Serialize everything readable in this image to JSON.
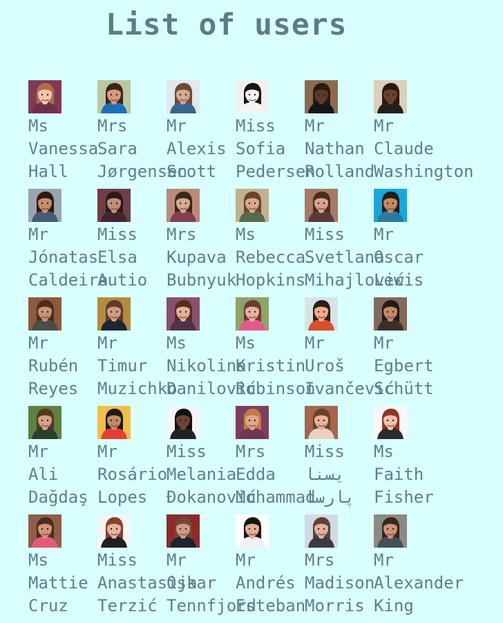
{
  "page": {
    "title": "List of users"
  },
  "users": [
    {
      "title": "Ms",
      "first": "Vanessa",
      "last": "Hall",
      "skin": "#f1c6b0",
      "hair": "#b06d4a",
      "shirt": "#6d2f4d",
      "bg": "#7f3a56"
    },
    {
      "title": "Mrs",
      "first": "Sara",
      "last": "Jørgensen",
      "skin": "#d79b7c",
      "hair": "#3d2418",
      "shirt": "#1e6fb5",
      "bg": "#b8c7a4"
    },
    {
      "title": "Mr",
      "first": "Alexis",
      "last": "Scott",
      "skin": "#d4a98f",
      "hair": "#6b4a38",
      "shirt": "#39648f",
      "bg": "#e3e6ea"
    },
    {
      "title": "Miss",
      "first": "Sofia",
      "last": "Pedersen",
      "skin": "#f1efef",
      "hair": "#161616",
      "shirt": "#f5f5f5",
      "bg": "#f0f0f0"
    },
    {
      "title": "Mr",
      "first": "Nathan",
      "last": "Rolland",
      "skin": "#5b3a28",
      "hair": "#2a1a12",
      "shirt": "#161616",
      "bg": "#8b6b4e"
    },
    {
      "title": "Mr",
      "first": "Claude",
      "last": "Washington",
      "skin": "#6b412b",
      "hair": "#2b190f",
      "shirt": "#202020",
      "bg": "#d9d0bd"
    },
    {
      "title": "Mr",
      "first": "Jónatas",
      "last": "Caldeira",
      "skin": "#c98e6a",
      "hair": "#2d1b12",
      "shirt": "#455b71",
      "bg": "#9aa4b0"
    },
    {
      "title": "Miss",
      "first": "Elsa",
      "last": "Autio",
      "skin": "#c18f79",
      "hair": "#2a1a15",
      "shirt": "#43242b",
      "bg": "#6e3e47"
    },
    {
      "title": "Mrs",
      "first": "Kupava",
      "last": "Bubnyuk",
      "skin": "#d4aa92",
      "hair": "#3b261c",
      "shirt": "#813f50",
      "bg": "#b98a7a"
    },
    {
      "title": "Ms",
      "first": "Rebecca",
      "last": "Hopkins",
      "skin": "#d9a98d",
      "hair": "#6a4330",
      "shirt": "#566b4b",
      "bg": "#c3b08f"
    },
    {
      "title": "Miss",
      "first": "Svetlana",
      "last": "Mihajlović",
      "skin": "#d8a38a",
      "hair": "#4a2d21",
      "shirt": "#5d3a33",
      "bg": "#a57a66"
    },
    {
      "title": "Mr",
      "first": "Oscar",
      "last": "Lewis",
      "skin": "#c18a62",
      "hair": "#1d1d22",
      "shirt": "#2b7ba0",
      "bg": "#1aa7d7"
    },
    {
      "title": "Mr",
      "first": "Rubén",
      "last": "Reyes",
      "skin": "#c99476",
      "hair": "#4b2e1d",
      "shirt": "#4d4c48",
      "bg": "#8d5b3c"
    },
    {
      "title": "Mr",
      "first": "Timur",
      "last": "Muzichko",
      "skin": "#d19b7d",
      "hair": "#5a3d2a",
      "shirt": "#1d2433",
      "bg": "#b28b3e"
    },
    {
      "title": "Ms",
      "first": "Nikolina",
      "last": "Danilović",
      "skin": "#dfb19a",
      "hair": "#5b2b18",
      "shirt": "#51324b",
      "bg": "#885070"
    },
    {
      "title": "Ms",
      "first": "Kristin",
      "last": "Robinson",
      "skin": "#e1b3a2",
      "hair": "#6c3b2e",
      "shirt": "#e05b8d",
      "bg": "#8ea26a"
    },
    {
      "title": "Mr",
      "first": "Uroš",
      "last": "Ivančević",
      "skin": "#f0ad8e",
      "hair": "#2d1e17",
      "shirt": "#d84f2f",
      "bg": "#d8e3e6"
    },
    {
      "title": "Mr",
      "first": "Egbert",
      "last": "Schütt",
      "skin": "#c48a68",
      "hair": "#261914",
      "shirt": "#3b2f2a",
      "bg": "#7f6a5d"
    },
    {
      "title": "Mr",
      "first": "Ali",
      "last": "Dağdaş",
      "skin": "#d4a384",
      "hair": "#563621",
      "shirt": "#2b3f2d",
      "bg": "#5e8141"
    },
    {
      "title": "Mr",
      "first": "Rosário",
      "last": "Lopes",
      "skin": "#c58b66",
      "hair": "#1f1a16",
      "shirt": "#e33e31",
      "bg": "#f2be49"
    },
    {
      "title": "Miss",
      "first": "Melania",
      "last": "Đokanović",
      "skin": "#6a4534",
      "hair": "#111111",
      "shirt": "#222222",
      "bg": "#f4f4f4"
    },
    {
      "title": "Mrs",
      "first": "Edda",
      "last": "Mohammad",
      "skin": "#e0a68f",
      "hair": "#c27a45",
      "shirt": "#6e3652",
      "bg": "#7c3f5f"
    },
    {
      "title": "Miss",
      "first": "یسنا",
      "last": "پارسا",
      "skin": "#e7b39a",
      "hair": "#6c3f2d",
      "shirt": "#e7d2c4",
      "bg": "#a7654c"
    },
    {
      "title": "Ms",
      "first": "Faith",
      "last": "Fisher",
      "skin": "#f0c3ad",
      "hair": "#8a3828",
      "shirt": "#2c2c2c",
      "bg": "#f7f7f7"
    },
    {
      "title": "Ms",
      "first": "Mattie",
      "last": "Cruz",
      "skin": "#d49477",
      "hair": "#4c2c21",
      "shirt": "#e45a79",
      "bg": "#8d5f4b"
    },
    {
      "title": "Miss",
      "first": "Anastasija",
      "last": "Terzić",
      "skin": "#e2b6a0",
      "hair": "#8a3f2f",
      "shirt": "#202020",
      "bg": "#f5f5f5"
    },
    {
      "title": "Mr",
      "first": "Oskar",
      "last": "Tennfjord",
      "skin": "#d29b81",
      "hair": "#6e4a36",
      "shirt": "#1c2230",
      "bg": "#8b2c28"
    },
    {
      "title": "Mr",
      "first": "Andrés",
      "last": "Esteban",
      "skin": "#e0b09a",
      "hair": "#161616",
      "shirt": "#f0f0f0",
      "bg": "#ffffff"
    },
    {
      "title": "Mrs",
      "first": "Madison",
      "last": "Morris",
      "skin": "#e0b39c",
      "hair": "#5e4130",
      "shirt": "#3a3a44",
      "bg": "#d2d9e8"
    },
    {
      "title": "Mr",
      "first": "Alexander",
      "last": "King",
      "skin": "#c99479",
      "hair": "#37281f",
      "shirt": "#45505a",
      "bg": "#8c8a82"
    }
  ]
}
